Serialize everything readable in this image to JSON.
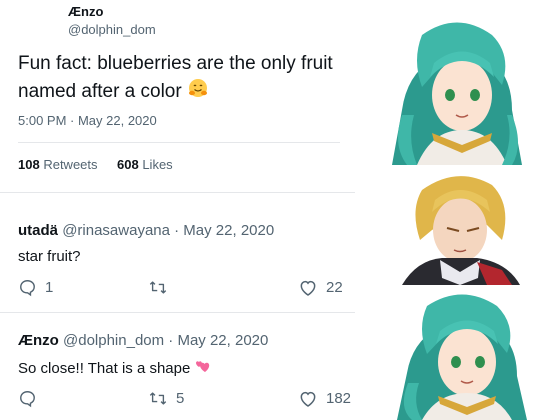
{
  "main_tweet": {
    "author_name": "Ænzo",
    "author_handle": "@dolphin_dom",
    "text_line1": "Fun fact: blueberries are the only fruit",
    "text_line2": "named after a color",
    "emoji": "hugging-face",
    "timestamp": "5:00 PM · May 22, 2020",
    "retweets_count": "108",
    "retweets_label": "Retweets",
    "likes_count": "608",
    "likes_label": "Likes"
  },
  "replies": [
    {
      "name": "utadä",
      "handle_date": "@rinasawayana · May 22, 2020",
      "text": "star fruit?",
      "reply_count": "1",
      "retweet_count": "",
      "like_count": "22"
    },
    {
      "name": "Ænzo",
      "handle_date": "@dolphin_dom · May 22, 2020",
      "text": "So close!! That is a shape",
      "emoji": "two-hearts",
      "reply_count": "",
      "retweet_count": "5",
      "like_count": "182"
    }
  ],
  "colors": {
    "text": "#0f1419",
    "muted": "#536471",
    "divider": "#e5e7ea",
    "teal_hair": "#3fb7a8",
    "blonde_hair": "#e0b64a"
  }
}
